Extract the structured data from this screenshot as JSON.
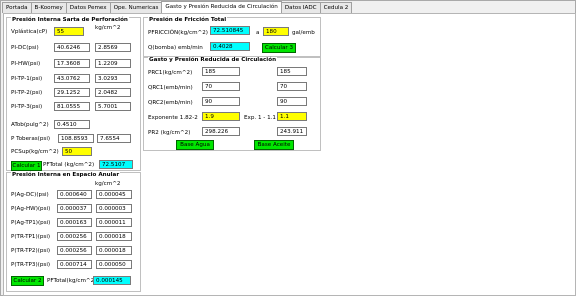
{
  "tabs": [
    "Portada",
    "B-Koomey",
    "Datos Pemex",
    "Ope. Numericas",
    "Gasto y Presión Reducida de Circulación",
    "Datos IADC",
    "Cedula 2"
  ],
  "sarta": {
    "title": "Presión Interna Sarta de Perforación",
    "unit": "kg/cm^2",
    "vplastica_label": "Vplástica(cP)",
    "vplastica": "55",
    "rows": [
      {
        "label": "PI-DC(psi)",
        "psi": "40.6246",
        "kg": "2.8569"
      },
      {
        "label": "PI-HW(psi)",
        "psi": "17.3608",
        "kg": "1.2209"
      },
      {
        "label": "PI-TP-1(psi)",
        "psi": "43.0762",
        "kg": "3.0293"
      },
      {
        "label": "PI-TP-2(psi)",
        "psi": "29.1252",
        "kg": "2.0482"
      },
      {
        "label": "PI-TP-3(psi)",
        "psi": "81.0555",
        "kg": "5.7001"
      }
    ],
    "atob_label": "ATob(pulg^2)",
    "atob": "0.4510",
    "ptob_label": "P Toberas(psi)",
    "ptob_psi": "108.8593",
    "ptob_kg": "7.6554",
    "pcsup_label": "PCSup(kg/cm^2)",
    "pcsup": "50",
    "calc_button": "Calcular 1",
    "pftotal_label": "PFTotal (kg/cm^2)",
    "pftotal": "72.5107"
  },
  "anular": {
    "title": "Presión Interna en Espacio Anular",
    "unit": "kg/cm^2",
    "rows": [
      {
        "label": "P(Ag-DC)(psi)",
        "psi": "0.000640",
        "kg": "0.000045"
      },
      {
        "label": "P(Ag-HW)(psi)",
        "psi": "0.000037",
        "kg": "0.000003"
      },
      {
        "label": "P(Ag-TP1)(psi)",
        "psi": "0.000163",
        "kg": "0.000011"
      },
      {
        "label": "P(TR-TP1)(psi)",
        "psi": "0.000256",
        "kg": "0.000018"
      },
      {
        "label": "P(TR-TP2)(psi)",
        "psi": "0.000256",
        "kg": "0.000018"
      },
      {
        "label": "P(TR-TP3)(psi)",
        "psi": "0.000714",
        "kg": "0.000050"
      }
    ],
    "calc_button": "Calcular 2",
    "pftotal_label": "PFTotal(kg/cm^2)",
    "pftotal": "0.000145"
  },
  "friccion": {
    "title": "Presión de Fricción Total",
    "pfriccion_label": "PFRICCIÓN(kg/cm^2)",
    "pfriccion": "72.510845",
    "a_label": "a",
    "gasto": "180",
    "gasto_unit": "gal/emb",
    "qbomba_label": "Q(bomba) emb/min",
    "qbomba": "0.4028",
    "calc_button": "Calcular 3"
  },
  "reducida": {
    "title": "Gasto y Presión Reducida de Circulación",
    "rows": [
      {
        "label": "PRC1(kg/cm^2)",
        "a": "185",
        "b": "185"
      },
      {
        "label": "QRC1(emb/min)",
        "a": "70",
        "b": "70"
      },
      {
        "label": "QRC2(emb/min)",
        "a": "90",
        "b": "90"
      }
    ],
    "exp_label": "Exponente 1.82-2",
    "exp_value": "1.9",
    "exp_range_label": "Exp. 1 - 1.1",
    "exp_range_value": "1.1",
    "pr2_label": "PR2 (kg/cm^2)",
    "pr2_a": "298.226",
    "pr2_b": "243.911",
    "base_agua": "Base Agua",
    "base_aceite": "Base Aceite"
  }
}
